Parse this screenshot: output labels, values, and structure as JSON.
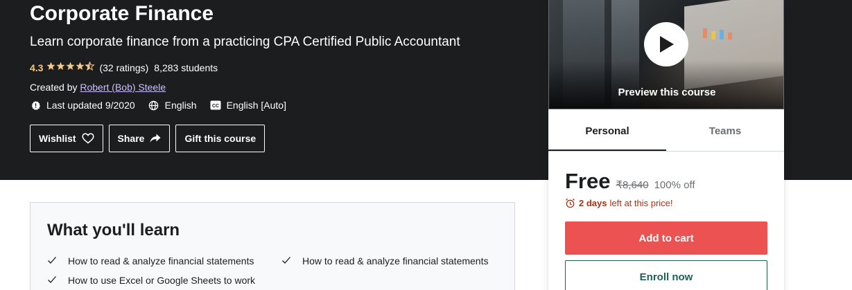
{
  "course": {
    "title": "Corporate Finance",
    "subtitle": "Learn corporate finance from a practicing CPA Certified Public Accountant",
    "rating": "4.3",
    "ratings_count": "(32 ratings)",
    "students": "8,283 students",
    "created_by_label": "Created by",
    "author": "Robert (Bob) Steele",
    "last_updated": "Last updated 9/2020",
    "language": "English",
    "captions": "English [Auto]"
  },
  "actions": {
    "wishlist": "Wishlist",
    "share": "Share",
    "gift": "Gift this course"
  },
  "sidebar": {
    "preview_label": "Preview this course",
    "tabs": [
      {
        "label": "Personal",
        "active": true
      },
      {
        "label": "Teams",
        "active": false
      }
    ],
    "price": "Free",
    "original_price": "₹8,640",
    "discount": "100% off",
    "deadline_bold": "2 days",
    "deadline_rest": "left at this price!",
    "add_to_cart": "Add to cart",
    "enroll_now": "Enroll now"
  },
  "learn": {
    "title": "What you'll learn",
    "items": [
      "How to read & analyze financial statements",
      "How to read & analyze financial statements",
      "How to use Excel or Google Sheets to work"
    ]
  },
  "colors": {
    "hero_bg": "#1c1d1f",
    "star": "#f3ca8c",
    "link": "#cec0fc",
    "cta": "#ec5252",
    "enroll": "#1e6055",
    "deadline": "#b32d0f"
  },
  "icons": {
    "stars": "star-rating-icons",
    "updated": "alert-badge-icon",
    "language": "globe-icon",
    "captions": "closed-captions-icon",
    "wishlist": "heart-icon",
    "share": "share-arrow-icon",
    "play": "play-icon",
    "deadline": "alarm-clock-icon",
    "learn_item": "checkmark-icon"
  }
}
